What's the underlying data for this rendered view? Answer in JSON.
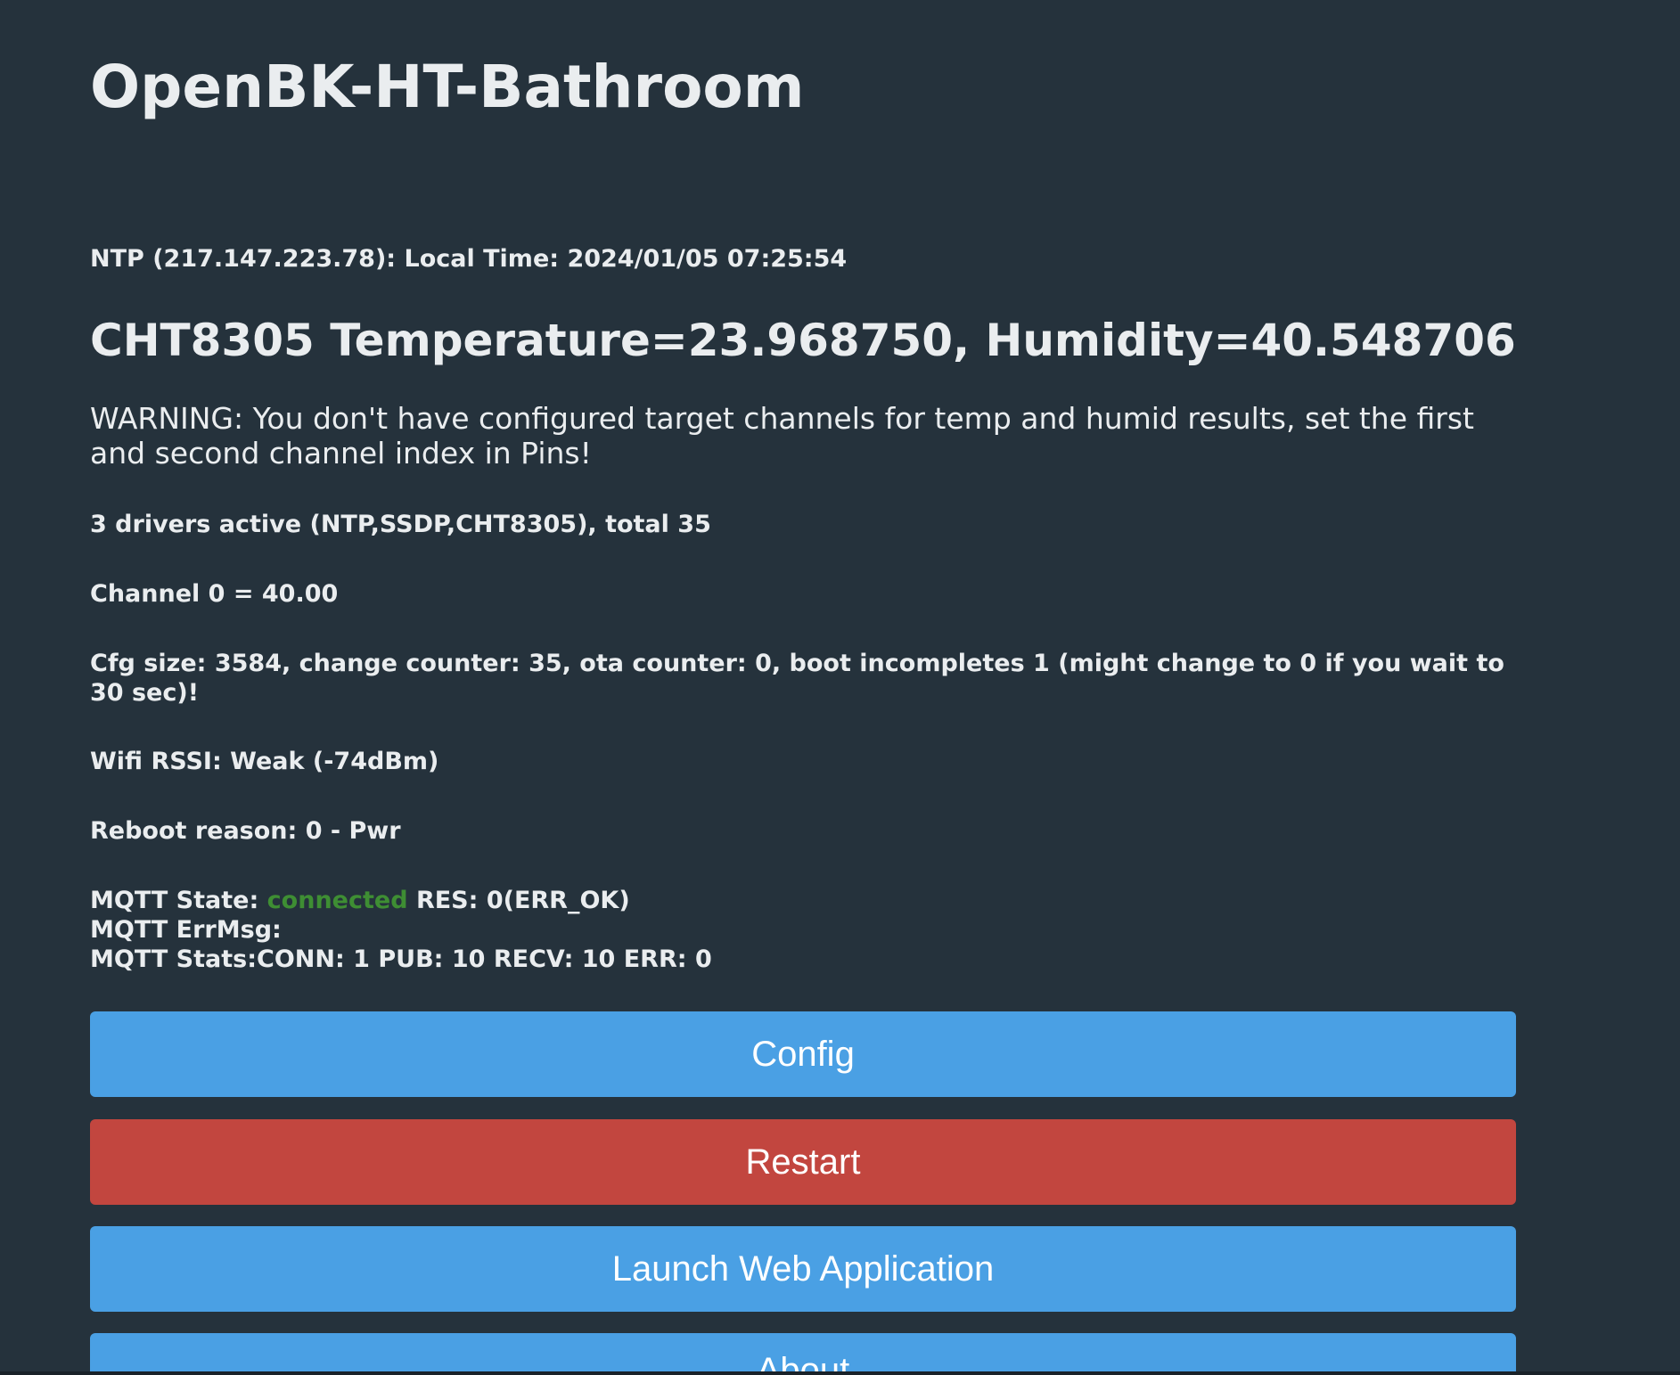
{
  "page": {
    "title": "OpenBK-HT-Bathroom"
  },
  "status": {
    "ntp": "NTP (217.147.223.78): Local Time: 2024/01/05 07:25:54",
    "sensor": "CHT8305 Temperature=23.968750, Humidity=40.548706",
    "warning": "WARNING: You don't have configured target channels for temp and humid results, set the first and second channel index in Pins!",
    "drivers": "3 drivers active (NTP,SSDP,CHT8305), total 35",
    "channel": "Channel 0 = 40.00",
    "cfg": "Cfg size: 3584, change counter: 35, ota counter: 0, boot incompletes 1 (might change to 0 if you wait to 30 sec)!",
    "wifi": "Wifi RSSI: Weak (-74dBm)",
    "reboot": "Reboot reason: 0 - Pwr",
    "mqtt": {
      "state_label": "MQTT State: ",
      "state_value": "connected",
      "state_res": " RES: 0(ERR_OK)",
      "errmsg": "MQTT ErrMsg: ",
      "stats": "MQTT Stats:CONN: 1 PUB: 10 RECV: 10 ERR: 0"
    }
  },
  "buttons": {
    "config": "Config",
    "restart": "Restart",
    "launch": "Launch Web Application",
    "about": "About"
  },
  "colors": {
    "background": "#25323c",
    "text": "#eaedef",
    "connected": "#3e8e33",
    "button_blue": "#4aa0e4",
    "button_red": "#c2463f"
  }
}
